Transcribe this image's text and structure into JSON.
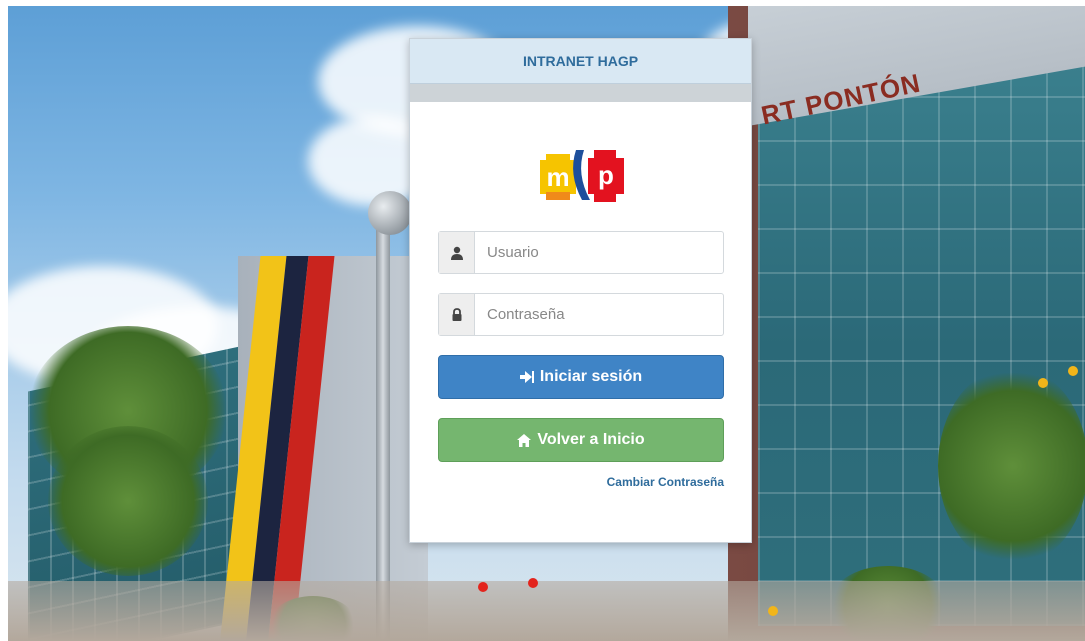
{
  "panel": {
    "title": "INTRANET HAGP"
  },
  "logo": {
    "text_left": "m",
    "text_right": "p",
    "colors": {
      "yellow": "#f6c400",
      "orange": "#f08a1a",
      "blue": "#1d4f9c",
      "red": "#e3121f"
    }
  },
  "form": {
    "username": {
      "placeholder": "Usuario",
      "value": "",
      "icon": "user-icon"
    },
    "password": {
      "placeholder": "Contraseña",
      "value": "",
      "icon": "lock-icon"
    },
    "login_button": {
      "label": "Iniciar sesión",
      "icon": "sign-in-icon"
    },
    "home_button": {
      "label": "Volver a Inicio",
      "icon": "home-icon"
    },
    "change_password_link": "Cambiar Contraseña"
  },
  "background": {
    "sign": "RT PONTÓN"
  },
  "colors": {
    "primary": "#3f84c6",
    "success": "#75b66f",
    "header_bg": "#d9e8f3",
    "title_text": "#2f6c9c"
  }
}
